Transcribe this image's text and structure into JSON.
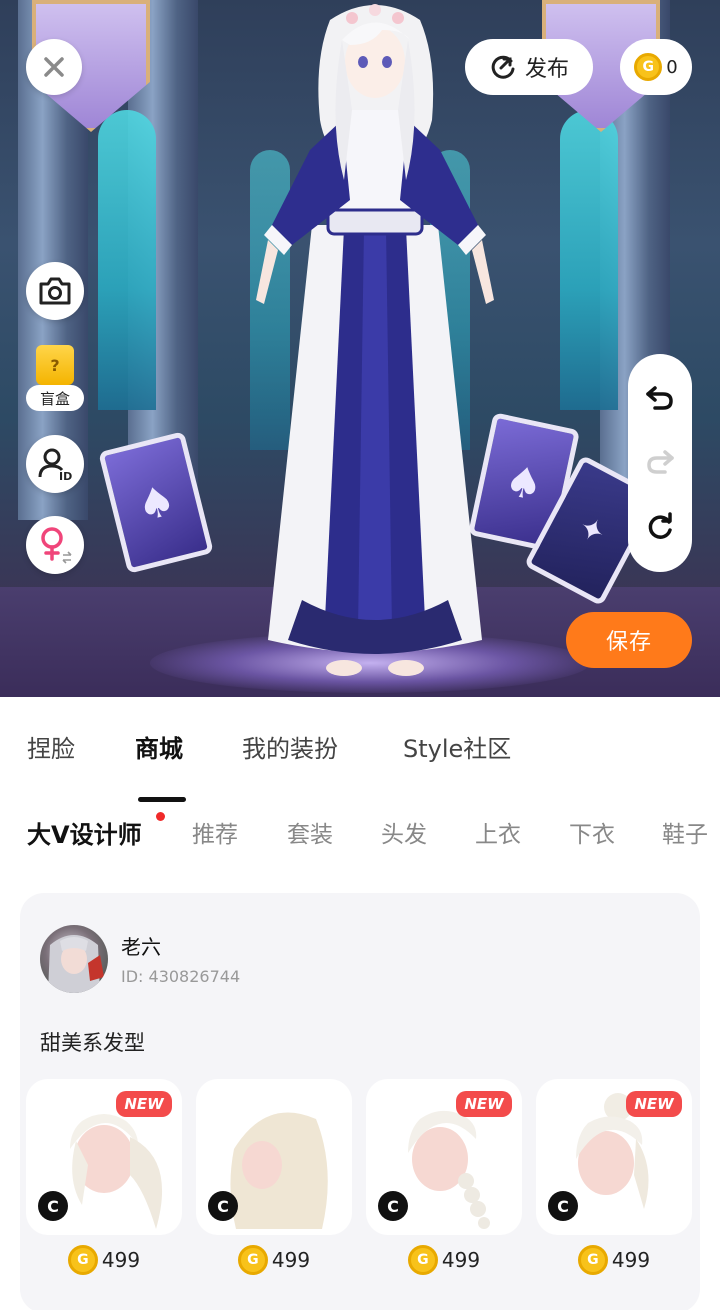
{
  "toolbar": {
    "publish_label": "发布",
    "coin_balance": "0",
    "blindbox_label": "盲盒",
    "blindbox_mark": "?",
    "save_label": "保存"
  },
  "main_tabs": [
    {
      "label": "捏脸",
      "active": false
    },
    {
      "label": "商城",
      "active": true
    },
    {
      "label": "我的装扮",
      "active": false
    },
    {
      "label": "Style社区",
      "active": false
    }
  ],
  "sub_tabs": [
    {
      "label": "大V设计师",
      "active": true,
      "has_dot": true
    },
    {
      "label": "推荐",
      "active": false
    },
    {
      "label": "套装",
      "active": false
    },
    {
      "label": "头发",
      "active": false
    },
    {
      "label": "上衣",
      "active": false
    },
    {
      "label": "下衣",
      "active": false
    },
    {
      "label": "鞋子",
      "active": false
    }
  ],
  "designer": {
    "name": "老六",
    "id_text": "ID: 430826744",
    "collection_title": "甜美系发型"
  },
  "items": [
    {
      "is_new": true,
      "new_label": "NEW",
      "creator_mark": "C",
      "price": "499",
      "style": "twin-tail"
    },
    {
      "is_new": false,
      "new_label": "",
      "creator_mark": "C",
      "price": "499",
      "style": "long-wavy"
    },
    {
      "is_new": true,
      "new_label": "NEW",
      "creator_mark": "C",
      "price": "499",
      "style": "braid"
    },
    {
      "is_new": true,
      "new_label": "NEW",
      "creator_mark": "C",
      "price": "499",
      "style": "bun"
    }
  ],
  "colors": {
    "accent_orange": "#ff7a1a",
    "new_badge_red": "#f34b4b",
    "coin_gold": "#f8c21a"
  }
}
